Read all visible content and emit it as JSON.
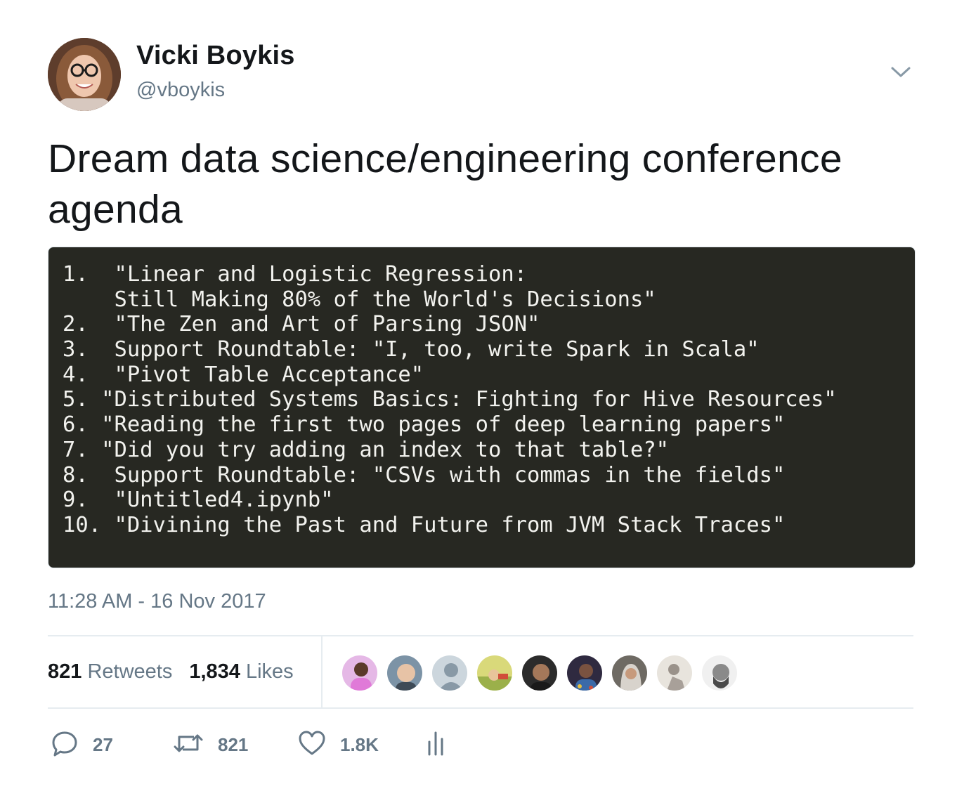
{
  "author": {
    "display_name": "Vicki Boykis",
    "handle": "@vboykis"
  },
  "tweet": {
    "text": "Dream data science/engineering conference agenda",
    "timestamp": "11:28 AM - 16 Nov 2017"
  },
  "code_image": {
    "lines": [
      "1.  \"Linear and Logistic Regression:",
      "    Still Making 80% of the World's Decisions\"",
      "2.  \"The Zen and Art of Parsing JSON\"",
      "3.  Support Roundtable: \"I, too, write Spark in Scala\"",
      "4.  \"Pivot Table Acceptance\"",
      "5. \"Distributed Systems Basics: Fighting for Hive Resources\"",
      "6. \"Reading the first two pages of deep learning papers\"",
      "7. \"Did you try adding an index to that table?\"",
      "8.  Support Roundtable: \"CSVs with commas in the fields\"",
      "9.  \"Untitled4.ipynb\"",
      "10. \"Divining the Past and Future from JVM Stack Traces\""
    ]
  },
  "stats": {
    "retweets_count": "821",
    "retweets_label": "Retweets",
    "likes_count": "1,834",
    "likes_label": "Likes"
  },
  "actions": {
    "reply_count": "27",
    "retweet_count": "821",
    "like_count": "1.8K"
  },
  "icons": {
    "caret": "chevron-down-icon",
    "reply": "reply-icon",
    "retweet": "retweet-icon",
    "like": "heart-icon",
    "analytics": "analytics-icon"
  },
  "colors": {
    "text": "#14171a",
    "secondary": "#657786",
    "divider": "#e6ecf0",
    "code_bg": "#272822",
    "code_text": "#f2f2ee"
  }
}
